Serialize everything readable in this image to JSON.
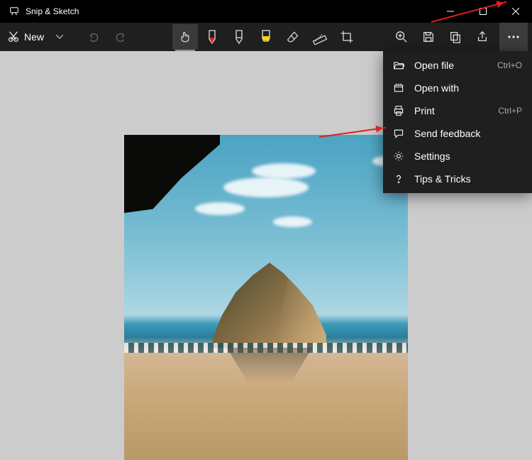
{
  "app": {
    "title": "Snip & Sketch"
  },
  "toolbar": {
    "new_label": "New"
  },
  "menu": {
    "items": [
      {
        "icon": "folder-open-icon",
        "label": "Open file",
        "shortcut": "Ctrl+O"
      },
      {
        "icon": "open-with-icon",
        "label": "Open with",
        "shortcut": ""
      },
      {
        "icon": "print-icon",
        "label": "Print",
        "shortcut": "Ctrl+P"
      },
      {
        "icon": "chat-icon",
        "label": "Send feedback",
        "shortcut": ""
      },
      {
        "icon": "gear-icon",
        "label": "Settings",
        "shortcut": ""
      },
      {
        "icon": "question-icon",
        "label": "Tips & Tricks",
        "shortcut": ""
      }
    ]
  },
  "colors": {
    "pen_ballpoint": "#e02020",
    "highlighter": "#ffd500"
  }
}
